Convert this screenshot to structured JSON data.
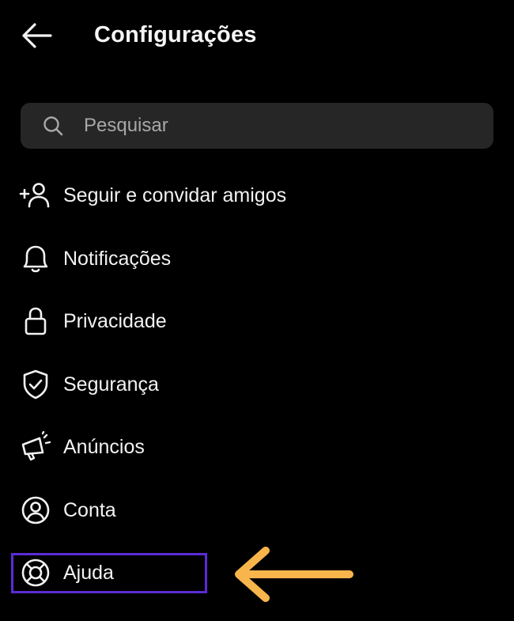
{
  "header": {
    "back_icon": "arrow-left-icon",
    "title": "Configurações"
  },
  "search": {
    "icon": "search-icon",
    "placeholder": "Pesquisar",
    "value": ""
  },
  "menu": {
    "items": [
      {
        "id": "follow-invite",
        "icon": "add-person-icon",
        "label": "Seguir e convidar amigos"
      },
      {
        "id": "notifications",
        "icon": "bell-icon",
        "label": "Notificações"
      },
      {
        "id": "privacy",
        "icon": "lock-icon",
        "label": "Privacidade"
      },
      {
        "id": "security",
        "icon": "shield-check-icon",
        "label": "Segurança"
      },
      {
        "id": "ads",
        "icon": "megaphone-icon",
        "label": "Anúncios"
      },
      {
        "id": "account",
        "icon": "user-circle-icon",
        "label": "Conta"
      },
      {
        "id": "help",
        "icon": "lifebuoy-icon",
        "label": "Ajuda"
      }
    ]
  },
  "annotation": {
    "highlighted_item": "help",
    "highlight_color": "#5b2cd6",
    "arrow_color": "#f7b54b"
  },
  "theme": {
    "background": "#000000",
    "text": "#f2f2f2",
    "search_background": "#262626"
  }
}
